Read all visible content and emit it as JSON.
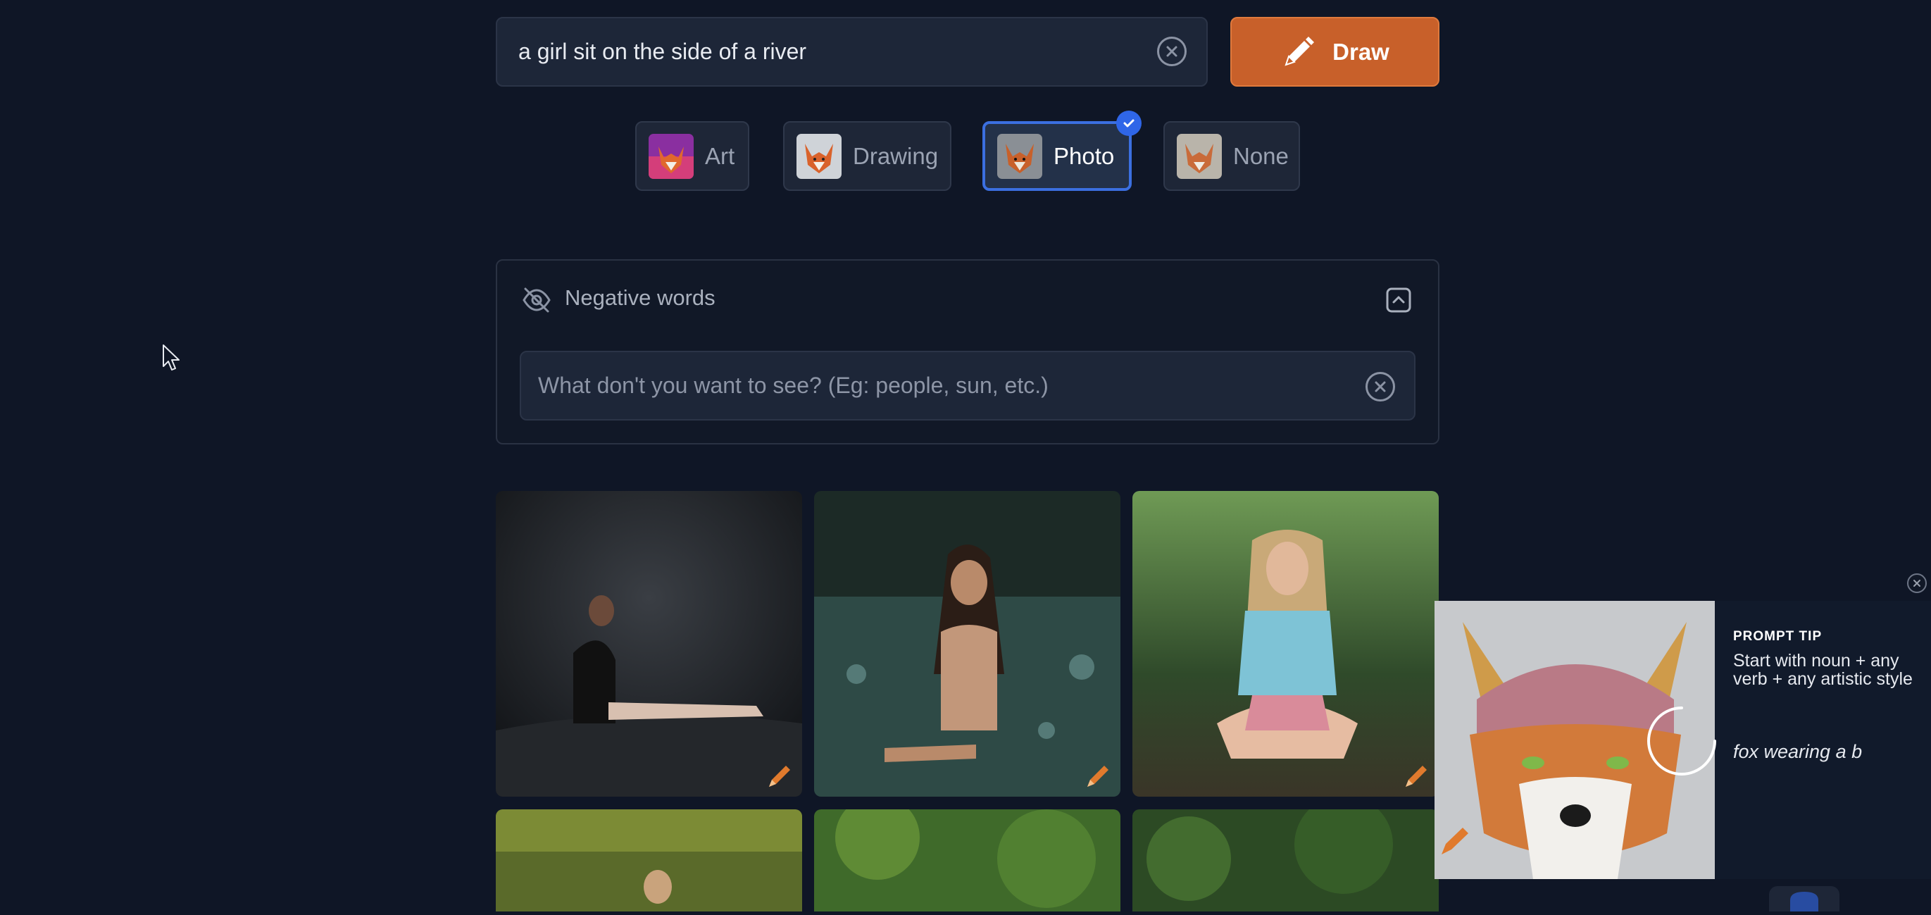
{
  "prompt": {
    "value": "a girl sit on the side of a river"
  },
  "draw_button": {
    "label": "Draw"
  },
  "styles": [
    {
      "label": "Art",
      "selected": false
    },
    {
      "label": "Drawing",
      "selected": false
    },
    {
      "label": "Photo",
      "selected": true
    },
    {
      "label": "None",
      "selected": false
    }
  ],
  "negative": {
    "title": "Negative words",
    "placeholder": "What don't you want to see? (Eg: people, sun, etc.)"
  },
  "gallery": {
    "items": [
      {
        "alt": "Girl in black dress sitting on dark riverbank"
      },
      {
        "alt": "Girl with long hair sitting in river water"
      },
      {
        "alt": "Girl in blue t-shirt sitting cross-legged by water"
      },
      {
        "alt": "Girl by the river in forest"
      },
      {
        "alt": "Green forest river scene"
      },
      {
        "alt": "Green blurred forest scene"
      }
    ]
  },
  "tip": {
    "label": "PROMPT TIP",
    "body": "Start with noun + any verb + any artistic style",
    "example": "fox wearing a b"
  },
  "colors": {
    "background": "#0f1626",
    "accent": "#c8602a",
    "selected": "#3b6fe0"
  }
}
